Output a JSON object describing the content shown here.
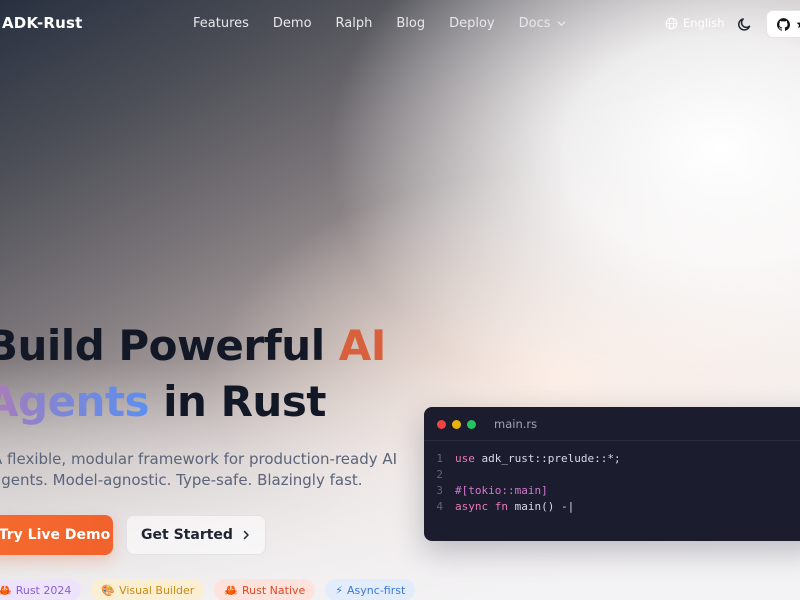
{
  "nav": {
    "brand": "ADK-Rust",
    "links": [
      "Features",
      "Demo",
      "Ralph",
      "Blog",
      "Deploy",
      "Docs"
    ],
    "language": "English"
  },
  "hero": {
    "title_line1_a": "Build Powerful ",
    "title_line1_b": "AI",
    "title_line2_a": "Agents",
    "title_line2_b": " in Rust",
    "subtitle_line1": "A flexible, modular framework for production-ready AI",
    "subtitle_line2": "agents. Model-agnostic. Type-safe. Blazingly fast.",
    "primary_cta": "Try Live Demo",
    "secondary_cta": "Get Started",
    "badges": [
      {
        "icon": "crab-icon",
        "label": "Rust 2024"
      },
      {
        "icon": "palette-icon",
        "label": "Visual Builder"
      },
      {
        "icon": "crab-icon",
        "label": "Rust Native"
      },
      {
        "icon": "lightning-icon",
        "label": "Async-first"
      }
    ]
  },
  "code": {
    "filename": "main.rs",
    "lines": [
      {
        "num": "1",
        "kw": "use",
        "rest": " adk_rust::prelude::*;"
      },
      {
        "num": "2",
        "kw": "",
        "rest": ""
      },
      {
        "num": "3",
        "kw": "#[tokio::main]",
        "rest": ""
      },
      {
        "num": "4",
        "kw": "async fn",
        "rest": " main() -|"
      }
    ]
  },
  "colors": {
    "accent_orange": "#f2622c",
    "code_bg": "#1b1d2e",
    "title_text": "#131826"
  }
}
